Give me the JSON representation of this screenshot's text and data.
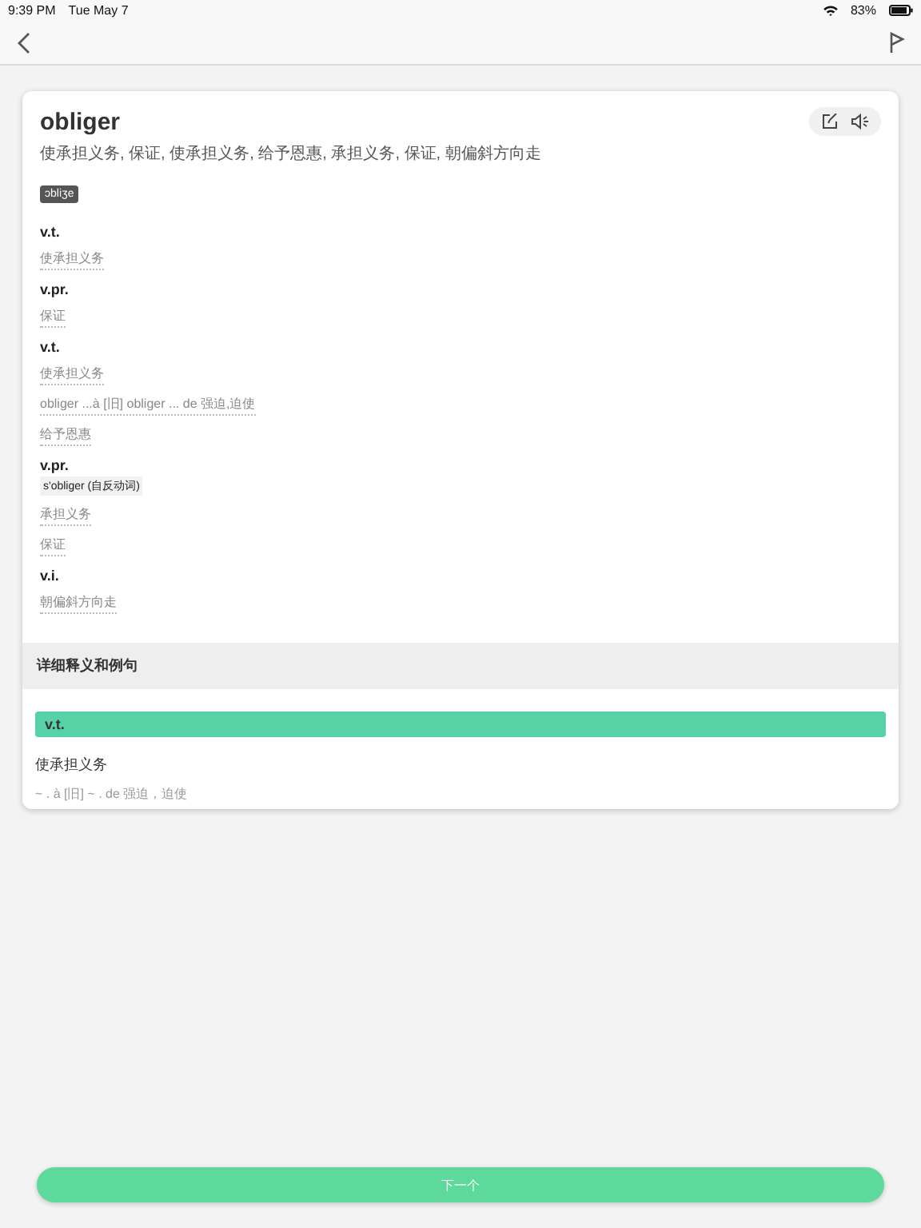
{
  "status_bar": {
    "time": "9:39 PM",
    "date": "Tue May 7",
    "battery": "83%"
  },
  "word": {
    "headword": "obliger",
    "summary": "使承担义务, 保证, 使承担义务, 给予恩惠, 承担义务, 保证, 朝偏斜方向走",
    "phonetic": "ɔbliʒe"
  },
  "groups": [
    {
      "pos": "v.t.",
      "senses": [
        "使承担义务"
      ]
    },
    {
      "pos": "v.pr.",
      "senses": [
        "保证"
      ]
    },
    {
      "pos": "v.t.",
      "senses": [
        "使承担义务",
        "obliger ...à [旧] obliger ... de 强迫,迫使",
        "给予恩惠"
      ]
    },
    {
      "pos": "v.pr.",
      "tag": "s'obliger (自反动词)",
      "senses": [
        "承担义务",
        "保证"
      ]
    },
    {
      "pos": "v.i.",
      "senses": [
        "朝偏斜方向走"
      ]
    }
  ],
  "details": {
    "title": "详细释义和例句",
    "pos": "v.t.",
    "meaning": "使承担义务",
    "example": "~ . à [旧] ~ . de 强迫，迫使"
  },
  "next_button": "下一个"
}
